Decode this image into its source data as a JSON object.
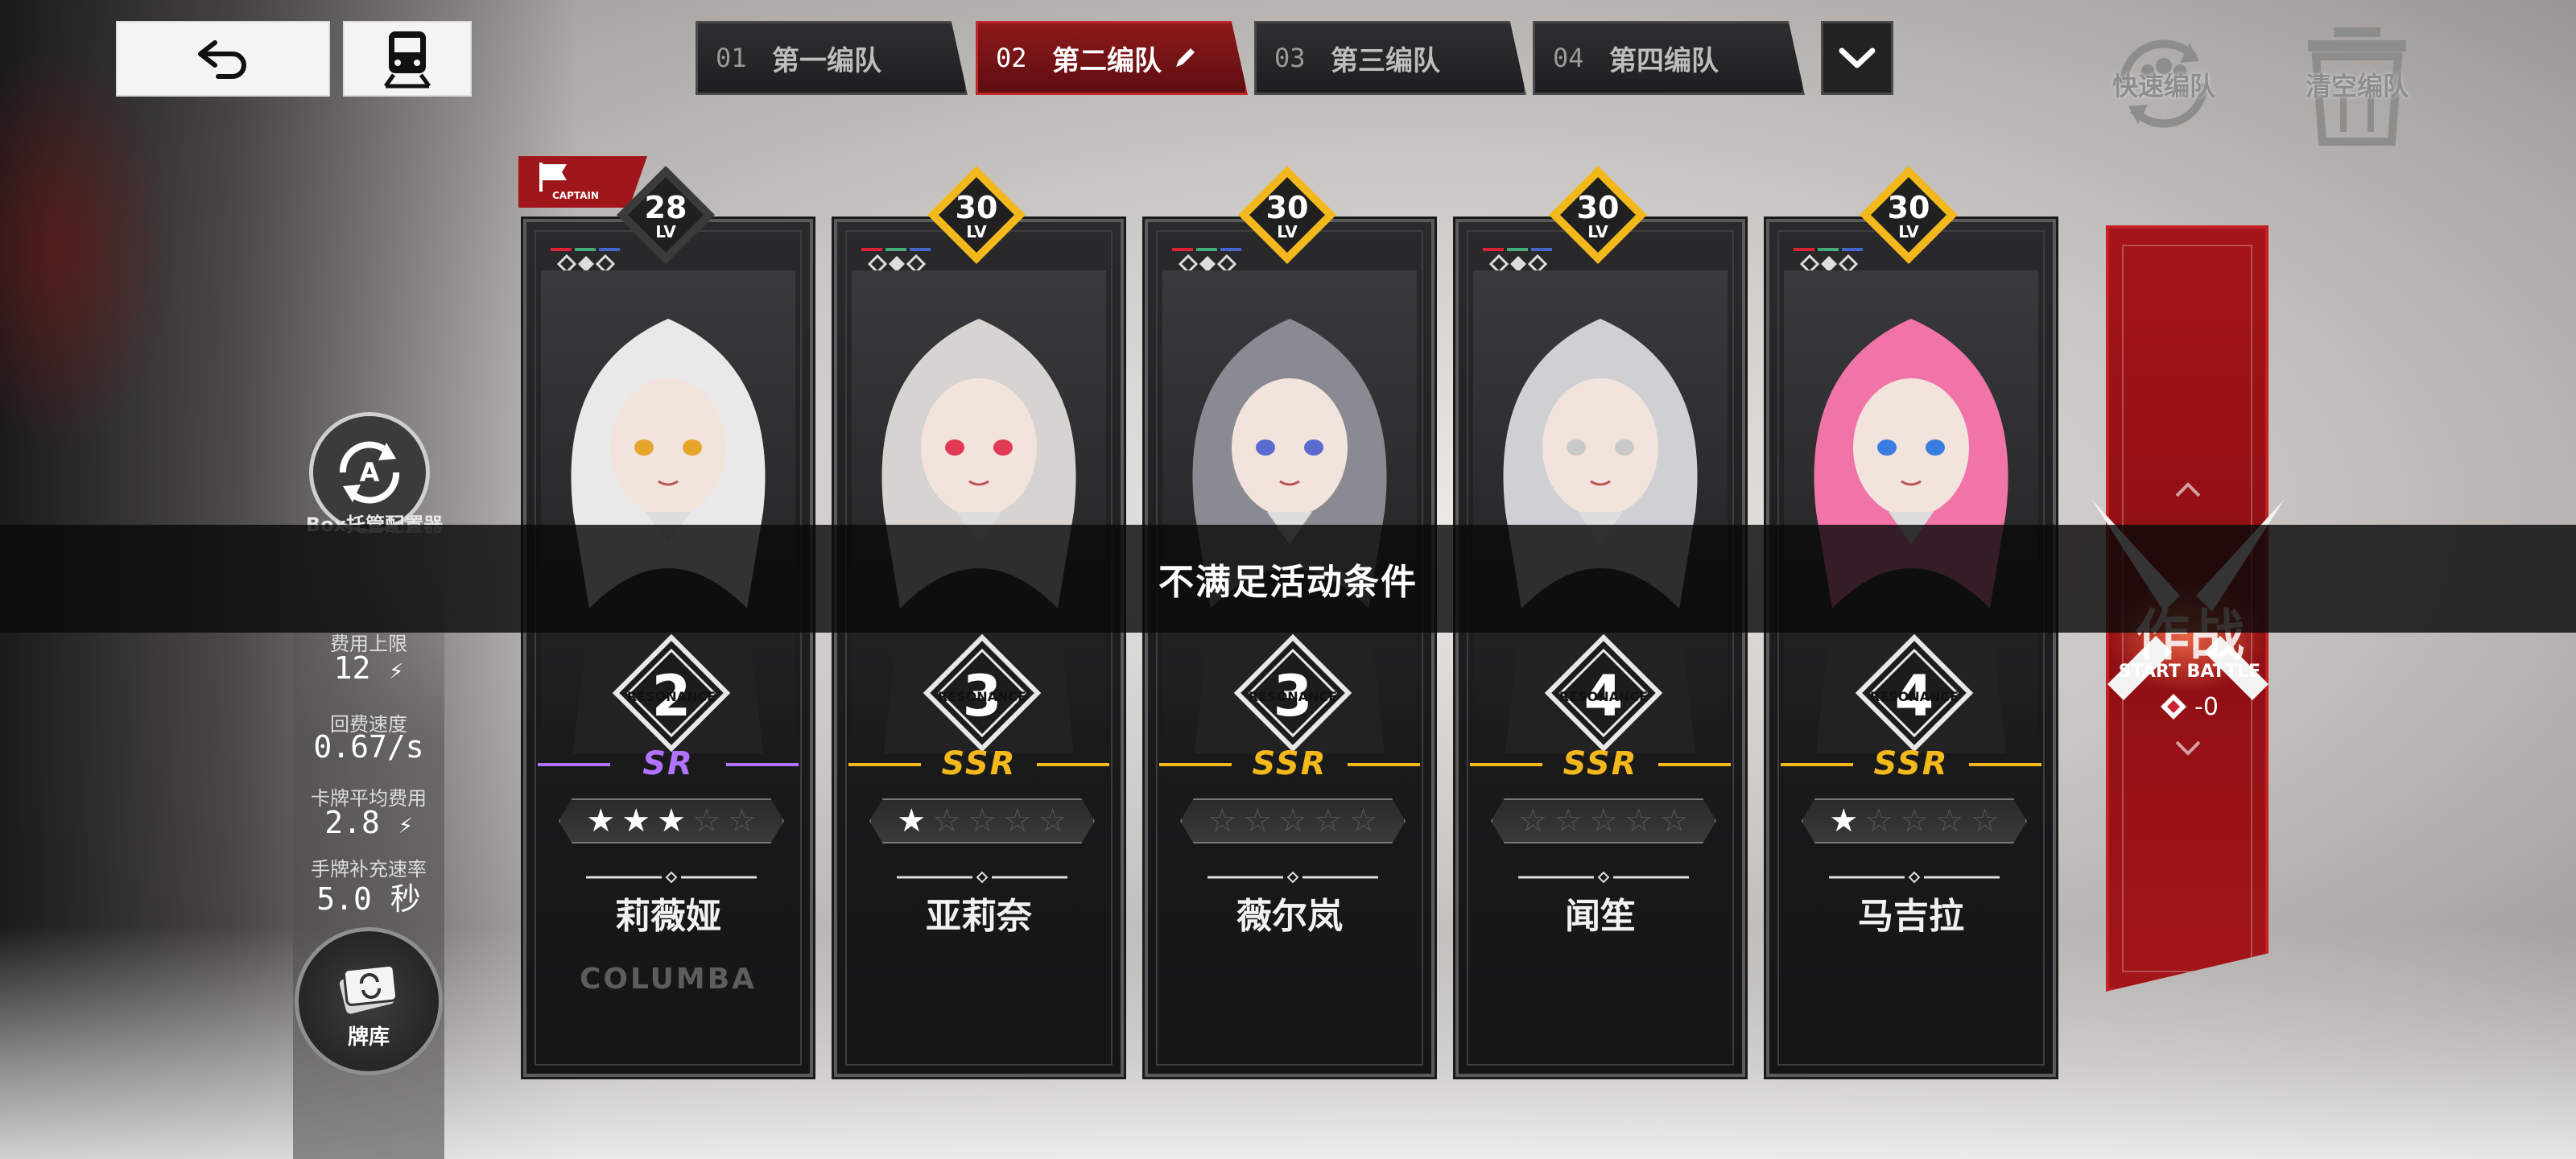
{
  "top_left": {
    "back_icon": "back-arrow-icon",
    "train_icon": "train-icon"
  },
  "tabs": [
    {
      "num": "01",
      "name": "第一编队",
      "active": false
    },
    {
      "num": "02",
      "name": "第二编队",
      "active": true
    },
    {
      "num": "03",
      "name": "第三编队",
      "active": false
    },
    {
      "num": "04",
      "name": "第四编队",
      "active": false
    }
  ],
  "tabs_more_icon": "chevron-down-icon",
  "top_right": {
    "quick_team": "快速编队",
    "clear_team": "清空编队"
  },
  "left_panel": {
    "box_auto_label": "Box托管配置器",
    "cost_cap_label": "费用上限",
    "cost_cap_value": "12",
    "regen_label": "回费速度",
    "regen_value": "0.67/s",
    "avg_cost_label": "卡牌平均费用",
    "avg_cost_value": "2.8",
    "refill_label": "手牌补充速率",
    "refill_value": "5.0 秒",
    "deck_label": "牌库"
  },
  "captain_label": "CAPTAIN",
  "level_suffix": "LV",
  "resonance_label": "RESONANCE",
  "cards": [
    {
      "name": "莉薇娅",
      "level": "28",
      "rarity": "SR",
      "rarity_color": "#b173ff",
      "stars": 3,
      "resonance": "2",
      "emblem": "COLUMBA",
      "hair": "#e9e9ea",
      "accent": "#e6a52d",
      "captain": true
    },
    {
      "name": "亚莉奈",
      "level": "30",
      "rarity": "SSR",
      "rarity_color": "#f2b81c",
      "stars": 1,
      "resonance": "3",
      "emblem": "",
      "hair": "#d7d3d0",
      "accent": "#e03a55",
      "captain": false
    },
    {
      "name": "薇尔岚",
      "level": "30",
      "rarity": "SSR",
      "rarity_color": "#f2b81c",
      "stars": 0,
      "resonance": "3",
      "emblem": "",
      "hair": "#8a8a93",
      "accent": "#5d6bd1",
      "captain": false
    },
    {
      "name": "闻笙",
      "level": "30",
      "rarity": "SSR",
      "rarity_color": "#f2b81c",
      "stars": 0,
      "resonance": "4",
      "emblem": "",
      "hair": "#cfd0d3",
      "accent": "#c9c9c9",
      "captain": false
    },
    {
      "name": "马吉拉",
      "level": "30",
      "rarity": "SSR",
      "rarity_color": "#f2b81c",
      "stars": 1,
      "resonance": "4",
      "emblem": "",
      "hair": "#f074a8",
      "accent": "#3a7de0",
      "captain": false
    }
  ],
  "battle": {
    "cn": "作战",
    "en": "START BATTLE",
    "cost": "-0"
  },
  "toast": "不满足活动条件",
  "colors": {
    "accent_red": "#a51418",
    "gold": "#f2b81c",
    "purple": "#b173ff"
  }
}
